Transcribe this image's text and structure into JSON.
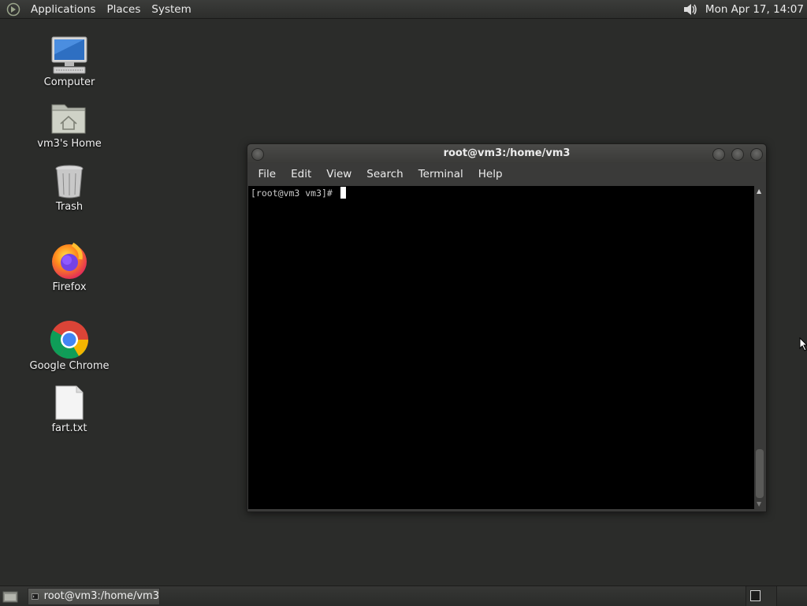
{
  "top_panel": {
    "menus": [
      "Applications",
      "Places",
      "System"
    ],
    "clock": "Mon Apr 17, 14:07"
  },
  "desktop_icons": [
    {
      "label": "Computer",
      "icon": "computer-icon"
    },
    {
      "label": "vm3's Home",
      "icon": "home-folder-icon"
    },
    {
      "label": "Trash",
      "icon": "trash-icon"
    },
    {
      "label": "Firefox",
      "icon": "firefox-icon"
    },
    {
      "label": "Google Chrome",
      "icon": "chrome-icon"
    },
    {
      "label": "fart.txt",
      "icon": "text-file-icon"
    }
  ],
  "terminal": {
    "title": "root@vm3:/home/vm3",
    "menus": [
      "File",
      "Edit",
      "View",
      "Search",
      "Terminal",
      "Help"
    ],
    "prompt": "[root@vm3 vm3]# "
  },
  "taskbar": {
    "tasks": [
      {
        "label": "root@vm3:/home/vm3",
        "icon": "terminal-icon"
      }
    ]
  },
  "colors": {
    "desktop": "#2b2c2a",
    "terminal_bg": "#000000",
    "panel": "#333432"
  }
}
